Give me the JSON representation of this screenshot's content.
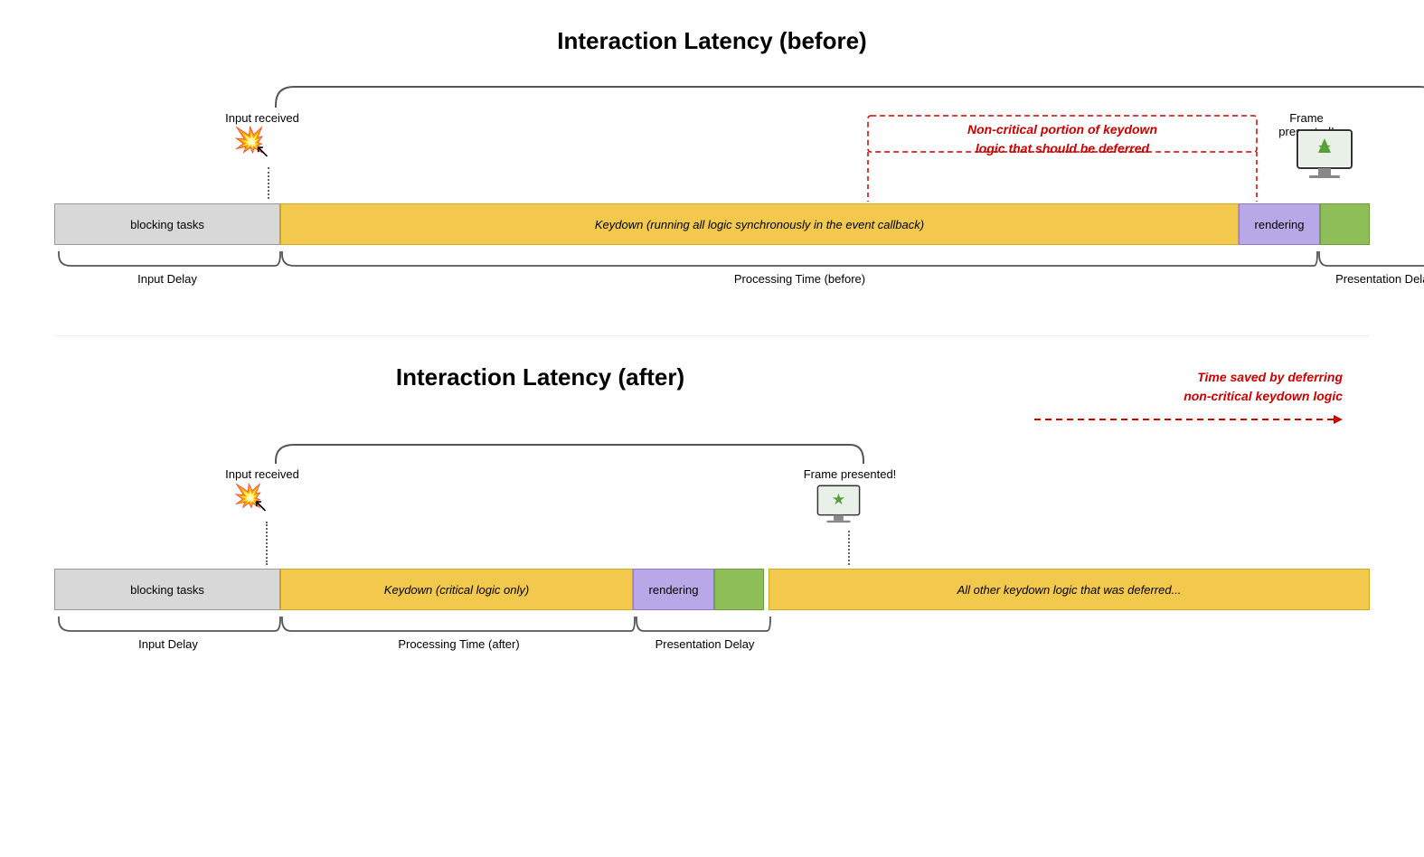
{
  "before": {
    "title": "Interaction Latency (before)",
    "input_received": "Input received",
    "frame_presented": "Frame presented!",
    "bars": {
      "blocking": "blocking tasks",
      "keydown": "Keydown (running all logic synchronously in the event callback)",
      "rendering": "rendering",
      "paint": ""
    },
    "labels": {
      "input_delay": "Input Delay",
      "processing_time": "Processing Time (before)",
      "presentation_delay": "Presentation Delay"
    },
    "annotation": "Non-critical portion of keydown\nlogic that should be deferred"
  },
  "after": {
    "title": "Interaction Latency (after)",
    "input_received": "Input received",
    "frame_presented": "Frame presented!",
    "bars": {
      "blocking": "blocking tasks",
      "keydown": "Keydown (critical logic only)",
      "rendering": "rendering",
      "paint": "",
      "deferred": "All other keydown logic that was deferred..."
    },
    "labels": {
      "input_delay": "Input Delay",
      "processing_time": "Processing Time (after)",
      "presentation_delay": "Presentation Delay"
    },
    "time_saved": "Time saved by deferring\nnon-critical keydown logic"
  }
}
